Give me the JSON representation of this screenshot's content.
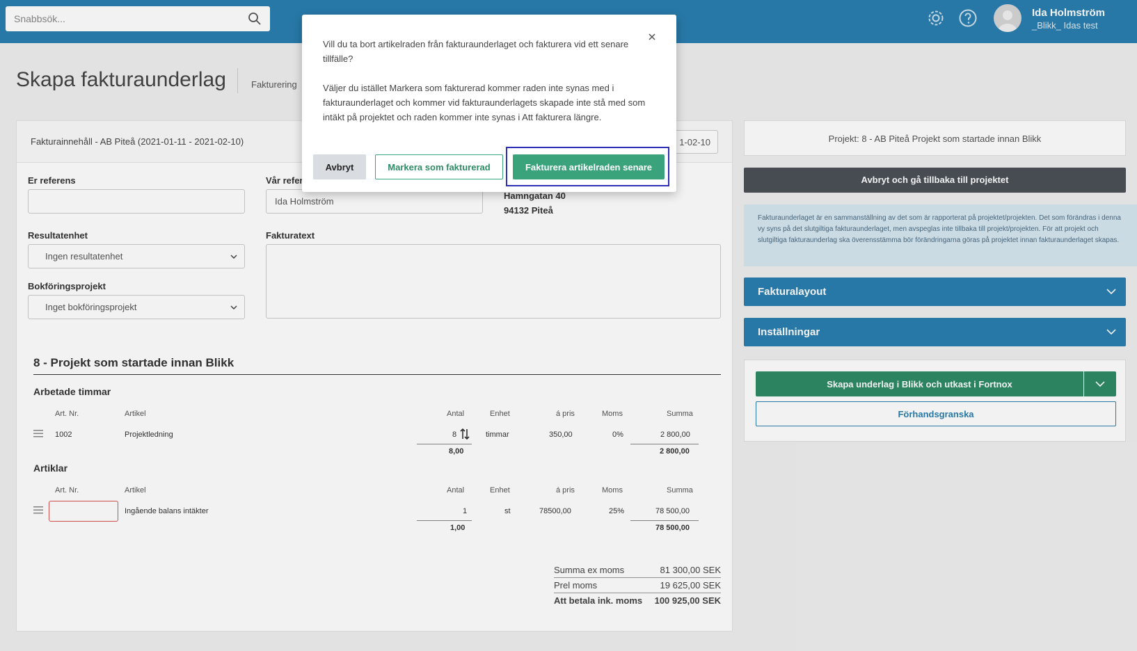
{
  "topbar": {
    "search_placeholder": "Snabbsök...",
    "user_name": "Ida Holmström",
    "user_org": "_Blikk_ Idas test",
    "icons": [
      "search-icon",
      "gear-icon",
      "help-icon",
      "avatar"
    ]
  },
  "header": {
    "title": "Skapa fakturaunderlag",
    "breadcrumb": "Fakturering"
  },
  "invoice": {
    "title": "Fakturainnehåll - AB Piteå (2021-01-11 - 2021-02-10)",
    "date_fragment": "1-02-10",
    "er_referens_label": "Er referens",
    "er_referens_value": "",
    "var_referens_label": "Vår refer",
    "var_referens_value": "Ida Holmström",
    "address_line1": "Hamngatan 40",
    "address_line2": "94132 Piteå",
    "resultatenhet_label": "Resultatenhet",
    "resultatenhet_value": "Ingen resultatenhet",
    "fakturatext_label": "Fakturatext",
    "bokforingsprojekt_label": "Bokföringsprojekt",
    "bokforingsprojekt_value": "Inget bokföringsprojekt"
  },
  "project": {
    "heading": "8 - Projekt som startade innan Blikk",
    "columns": {
      "artnr": "Art. Nr.",
      "artikel": "Artikel",
      "antal": "Antal",
      "enhet": "Enhet",
      "apris": "á pris",
      "moms": "Moms",
      "summa": "Summa"
    },
    "hours": {
      "title": "Arbetade timmar",
      "row": {
        "artnr": "1002",
        "artikel": "Projektledning",
        "antal": "8",
        "enhet": "timmar",
        "apris": "350,00",
        "moms": "0%",
        "summa": "2 800,00"
      },
      "total_antal": "8,00",
      "total_summa": "2 800,00"
    },
    "articles": {
      "title": "Artiklar",
      "row": {
        "artnr": "",
        "artikel": "Ingående balans intäkter",
        "antal": "1",
        "enhet": "st",
        "apris": "78500,00",
        "moms": "25%",
        "summa": "78 500,00"
      },
      "total_antal": "1,00",
      "total_summa": "78 500,00"
    }
  },
  "summary": {
    "ex_moms_label": "Summa ex moms",
    "ex_moms_value": "81 300,00 SEK",
    "prel_moms_label": "Prel moms",
    "prel_moms_value": "19 625,00 SEK",
    "total_label": "Att betala ink. moms",
    "total_value": "100 925,00 SEK"
  },
  "sidebar": {
    "project_label": "Projekt: 8 - AB Piteå Projekt som startade innan Blikk",
    "back_button": "Avbryt och gå tillbaka till projektet",
    "info_text": "Fakturaunderlaget är en sammanställning av det som är rapporterat på projektet/projekten. Det som förändras i denna vy syns på det slutgiltiga fakturaunderlaget, men avspeglas inte tillbaka till projekt/projekten. För att projekt och slutgiltiga fakturaunderlag ska överensstämma bör förändringarna göras på projektet innan fakturaunderlaget skapas.",
    "fakturalayout": "Fakturalayout",
    "installningar": "Inställningar",
    "create_button": "Skapa underlag i Blikk och utkast i Fortnox",
    "preview_button": "Förhandsgranska"
  },
  "modal": {
    "question": "Vill du ta bort artikelraden från fakturaunderlaget och fakturera vid ett senare tillfälle?",
    "explanation": "Väljer du istället Markera som fakturerad kommer raden inte synas med i fakturaunderlaget och kommer vid fakturaunderlagets skapade inte stå med som intäkt på projektet och raden kommer inte synas i Att fakturera längre.",
    "cancel": "Avbryt",
    "mark_invoiced": "Markera som fakturerad",
    "invoice_later": "Fakturera artikelraden senare"
  },
  "colors": {
    "topbar": "#2a7fb0",
    "primary_green": "#3aa37b",
    "dark_button": "#4a5157",
    "focus_outline": "#2d2db8"
  }
}
